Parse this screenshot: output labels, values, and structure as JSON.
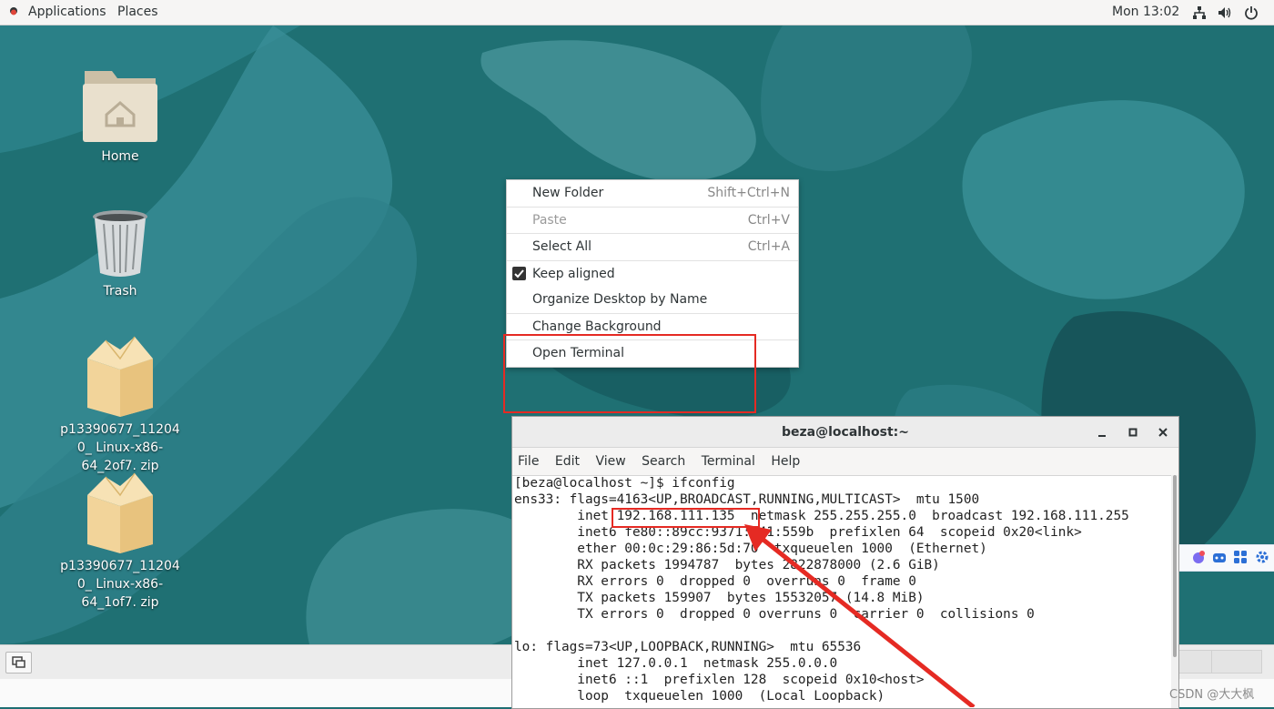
{
  "topbar": {
    "applications": "Applications",
    "places": "Places",
    "clock": "Mon 13:02",
    "tray_icons": [
      "network-icon",
      "volume-icon",
      "power-icon"
    ]
  },
  "desktop": {
    "icons": [
      {
        "label": "Home",
        "icon": "home-folder-icon"
      },
      {
        "label": "Trash",
        "icon": "trash-icon"
      },
      {
        "label": "p13390677_112040_ Linux-x86-64_2of7. zip",
        "icon": "archive-icon"
      },
      {
        "label": "p13390677_112040_ Linux-x86-64_1of7. zip",
        "icon": "archive-icon"
      }
    ]
  },
  "context_menu": {
    "items": [
      {
        "label": "New Folder",
        "accel": "Shift+Ctrl+N",
        "enabled": true
      },
      {
        "label": "Paste",
        "accel": "Ctrl+V",
        "enabled": false
      },
      {
        "label": "Select All",
        "accel": "Ctrl+A",
        "enabled": true
      },
      {
        "label": "Keep aligned",
        "accel": "",
        "enabled": true,
        "checked": true
      },
      {
        "label": "Organize Desktop by Name",
        "accel": "",
        "enabled": true
      },
      {
        "label": "Change Background",
        "accel": "",
        "enabled": true
      },
      {
        "label": "Open Terminal",
        "accel": "",
        "enabled": true
      }
    ]
  },
  "terminal": {
    "title": "beza@localhost:~",
    "menu": [
      "File",
      "Edit",
      "View",
      "Search",
      "Terminal",
      "Help"
    ],
    "lines": [
      "[beza@localhost ~]$ ifconfig",
      "ens33: flags=4163<UP,BROADCAST,RUNNING,MULTICAST>  mtu 1500",
      "        inet 192.168.111.135  netmask 255.255.255.0  broadcast 192.168.111.255",
      "        inet6 fe80::89cc:9371:141:559b  prefixlen 64  scopeid 0x20<link>",
      "        ether 00:0c:29:86:5d:70  txqueuelen 1000  (Ethernet)",
      "        RX packets 1994787  bytes 2822878000 (2.6 GiB)",
      "        RX errors 0  dropped 0  overruns 0  frame 0",
      "        TX packets 159907  bytes 15532057 (14.8 MiB)",
      "        TX errors 0  dropped 0 overruns 0  carrier 0  collisions 0",
      "",
      "lo: flags=73<UP,LOOPBACK,RUNNING>  mtu 65536",
      "        inet 127.0.0.1  netmask 255.0.0.0",
      "        inet6 ::1  prefixlen 128  scopeid 0x10<host>",
      "        loop  txqueuelen 1000  (Local Loopback)"
    ]
  },
  "watermark": "CSDN @大大枫",
  "colors": {
    "desktop": "#1d6e72",
    "annotation": "#e52a23"
  }
}
